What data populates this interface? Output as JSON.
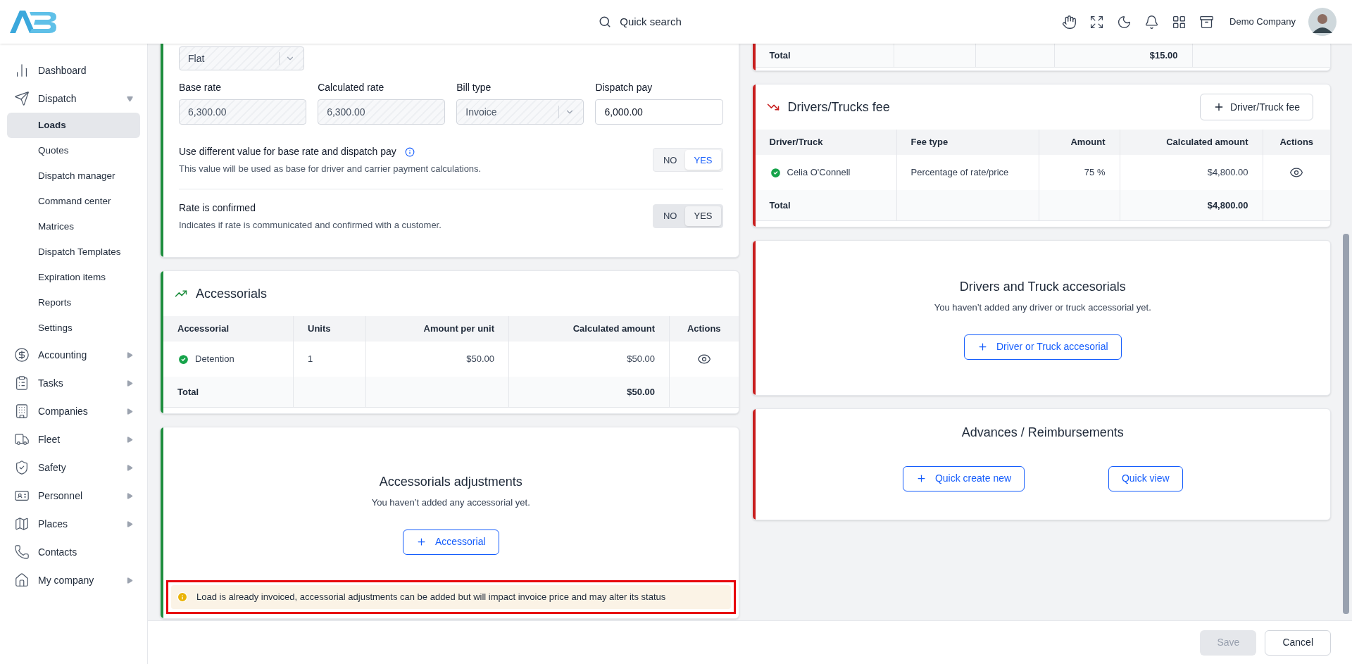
{
  "header": {
    "search": {
      "placeholder": "Quick search"
    },
    "company": "Demo Company"
  },
  "sidebar": {
    "items": [
      {
        "label": "Dashboard",
        "selected": false
      },
      {
        "label": "Dispatch",
        "selected": false,
        "expanded": true,
        "children": [
          {
            "label": "Loads",
            "selected": true
          },
          {
            "label": "Quotes",
            "selected": false
          },
          {
            "label": "Dispatch manager",
            "selected": false
          },
          {
            "label": "Command center",
            "selected": false
          },
          {
            "label": "Matrices",
            "selected": false
          },
          {
            "label": "Dispatch Templates",
            "selected": false
          },
          {
            "label": "Expiration items",
            "selected": false
          },
          {
            "label": "Reports",
            "selected": false
          },
          {
            "label": "Settings",
            "selected": false
          }
        ]
      },
      {
        "label": "Accounting",
        "selected": false,
        "expanded": false
      },
      {
        "label": "Tasks",
        "selected": false,
        "expanded": false
      },
      {
        "label": "Companies",
        "selected": false,
        "expanded": false
      },
      {
        "label": "Fleet",
        "selected": false,
        "expanded": false
      },
      {
        "label": "Safety",
        "selected": false,
        "expanded": false
      },
      {
        "label": "Personnel",
        "selected": false,
        "expanded": false
      },
      {
        "label": "Places",
        "selected": false,
        "expanded": false
      },
      {
        "label": "Contacts",
        "selected": false
      },
      {
        "label": "My company",
        "selected": false,
        "expanded": false
      }
    ]
  },
  "left_column": [
    {
      "kind": "rate",
      "color": "#1e8e3e",
      "rate_type": {
        "value": "Flat",
        "disabled": true
      },
      "fields": [
        {
          "label": "Base rate",
          "value": "6,300.00",
          "kind": "text",
          "disabled": true
        },
        {
          "label": "Calculated rate",
          "value": "6,300.00",
          "kind": "text",
          "disabled": true
        },
        {
          "label": "Bill type",
          "value": "Invoice",
          "kind": "select",
          "disabled": true
        },
        {
          "label": "Dispatch pay",
          "value": "6,000.00",
          "kind": "text",
          "disabled": false
        }
      ],
      "settings": [
        {
          "title": "Use different value for base rate and dispatch pay",
          "info": true,
          "description": "This value will be used as base for driver and carrier payment calculations.",
          "disabled": false,
          "options": [
            {
              "label": "NO",
              "selected": false
            },
            {
              "label": "YES",
              "selected": true
            }
          ]
        },
        {
          "title": "Rate is confirmed",
          "info": false,
          "description": "Indicates if rate is communicated and confirmed with a customer.",
          "disabled": true,
          "options": [
            {
              "label": "NO",
              "selected": false
            },
            {
              "label": "YES",
              "selected": true
            }
          ]
        }
      ]
    },
    {
      "kind": "table",
      "color": "#1e8e3e",
      "title": "Accessorials",
      "columns": [
        {
          "label": "Accessorial"
        },
        {
          "label": "Units"
        },
        {
          "label": "Amount per unit"
        },
        {
          "label": "Calculated amount"
        },
        {
          "label": "Actions"
        }
      ],
      "rows": [
        {
          "confirmed": true,
          "cells": [
            "Detention",
            "1",
            "$50.00",
            "$50.00"
          ]
        }
      ],
      "total": {
        "label": "Total",
        "amount": "$50.00"
      }
    },
    {
      "kind": "empty",
      "color": "#1e8e3e",
      "title": "Accessorials adjustments",
      "message": "You haven’t added any accessorial yet.",
      "button": "Accessorial",
      "notice": {
        "text": "Load is already invoiced, accessorial adjustments can be added but will impact invoice price and may alter its status",
        "highlighted": true
      }
    }
  ],
  "right_column": [
    {
      "kind": "total_strip",
      "color": "#c81e1e",
      "label": "Total",
      "amount": "$15.00"
    },
    {
      "kind": "table",
      "color": "#c81e1e",
      "title": "Drivers/Trucks fee",
      "button": "Driver/Truck fee",
      "columns": [
        {
          "label": "Driver/Truck"
        },
        {
          "label": "Fee type"
        },
        {
          "label": "Amount"
        },
        {
          "label": "Calculated amount"
        },
        {
          "label": "Actions"
        }
      ],
      "rows": [
        {
          "confirmed": true,
          "cells": [
            "Celia O'Connell",
            "Percentage of rate/price",
            "75 %",
            "$4,800.00"
          ]
        }
      ],
      "total": {
        "label": "Total",
        "amount": "$4,800.00"
      }
    },
    {
      "kind": "empty",
      "color": "#c81e1e",
      "title": "Drivers and Truck accesorials",
      "message": "You haven’t added any driver or truck accessorial yet.",
      "button": "Driver or Truck accesorial"
    },
    {
      "kind": "actions",
      "color": "#c81e1e",
      "title": "Advances / Reimbursements",
      "buttons": [
        {
          "label": "Quick create new",
          "plus": true
        },
        {
          "label": "Quick view",
          "plus": false
        }
      ]
    }
  ],
  "footer": {
    "buttons": [
      {
        "label": "Save",
        "disabled": true
      },
      {
        "label": "Cancel",
        "disabled": false
      }
    ]
  }
}
